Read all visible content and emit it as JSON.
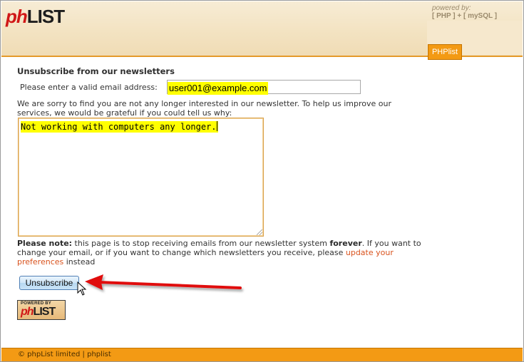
{
  "header": {
    "logo_prefix": "ph",
    "logo_suffix": "LIST",
    "powered_by_label": "powered by:",
    "powered_by_stack": "[ PHP ] + [ mySQL ]",
    "tab_label": "PHPlist"
  },
  "form": {
    "title": "Unsubscribe from our newsletters",
    "email_label": "Please enter a valid email address:",
    "email_value": "user001@example.com",
    "sorry_text": "We are sorry to find you are not any longer interested in our newsletter. To help us improve our services, we would be grateful if you could tell us why:",
    "reason_value": "Not working with computers any longer.",
    "note_bold": "Please note:",
    "note_text_1": " this page is to stop receiving emails from our newsletter system ",
    "note_forever": "forever",
    "note_text_2": ". If you want to change your email, or if you want to change which newsletters you receive, please ",
    "note_link": "update your preferences",
    "note_text_3": " instead",
    "submit_label": "Unsubscribe"
  },
  "badge": {
    "top": "POWERED BY",
    "logo_prefix": "ph",
    "logo_suffix": "LIST"
  },
  "footer": {
    "text": "© phpList limited | phplist"
  },
  "colors": {
    "accent": "#f39a14",
    "highlight": "#ffff00",
    "link": "#d9531e",
    "annotation_arrow": "#e01010"
  }
}
